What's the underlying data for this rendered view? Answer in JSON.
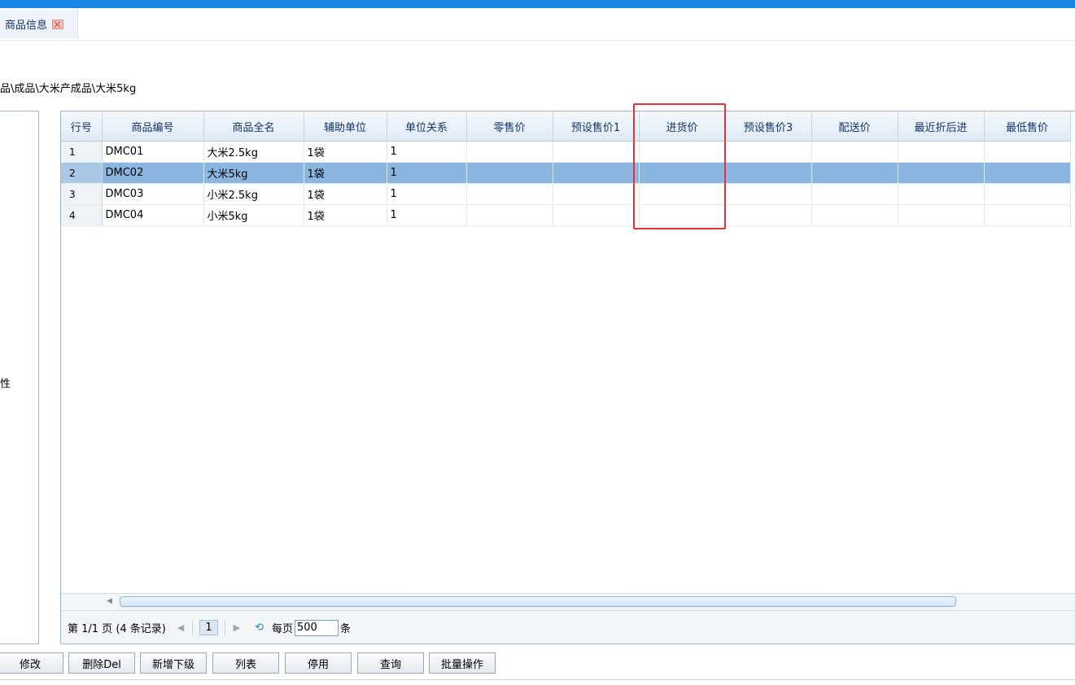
{
  "tab": {
    "label": "商品信息"
  },
  "breadcrumb": "品\\成品\\大米产成品\\大米5kg",
  "left_panel": {
    "label": "性"
  },
  "grid": {
    "columns": [
      "行号",
      "商品编号",
      "商品全名",
      "辅助单位",
      "单位关系",
      "零售价",
      "预设售价1",
      "进货价",
      "预设售价3",
      "配送价",
      "最近折后进",
      "最低售价"
    ],
    "rows": [
      {
        "no": "1",
        "code": "DMC01",
        "name": "大米2.5kg",
        "unit": "1袋",
        "rel": "1",
        "selected": false
      },
      {
        "no": "2",
        "code": "DMC02",
        "name": "大米5kg",
        "unit": "1袋",
        "rel": "1",
        "selected": true
      },
      {
        "no": "3",
        "code": "DMC03",
        "name": "小米2.5kg",
        "unit": "1袋",
        "rel": "1",
        "selected": false
      },
      {
        "no": "4",
        "code": "DMC04",
        "name": "小米5kg",
        "unit": "1袋",
        "rel": "1",
        "selected": false
      }
    ]
  },
  "pager": {
    "page_info": "第 1/1 页 (4 条记录)",
    "current_page": "1",
    "per_page_label": "每页",
    "per_page_value": "500",
    "unit_label": "条"
  },
  "toolbar": {
    "buttons": [
      "修改",
      "删除Del",
      "新增下级",
      "列表",
      "停用",
      "查询",
      "批量操作"
    ]
  },
  "colors": {
    "accent": "#1a86e4",
    "selected_row": "#8bb6e0",
    "highlight": "#e53232"
  }
}
